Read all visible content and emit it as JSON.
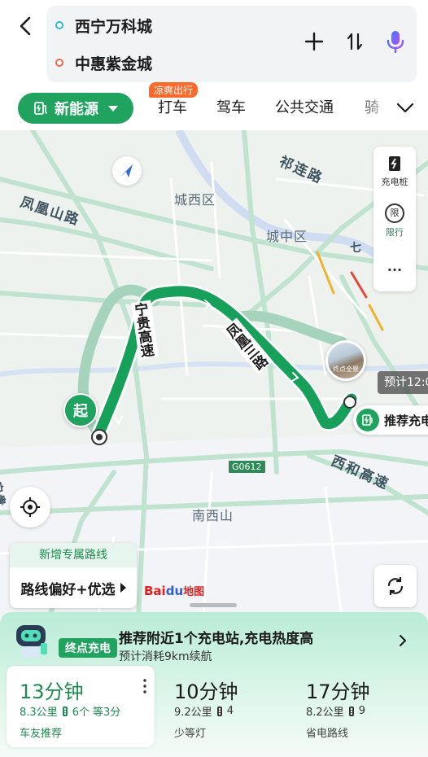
{
  "header": {
    "start": "西宁万科城",
    "end": "中惠紫金城"
  },
  "modes": {
    "nev_label": "新能源",
    "badge": "凉爽出行",
    "items": [
      "打车",
      "驾车",
      "公共交通",
      "骑"
    ]
  },
  "map": {
    "districts": [
      "城西区",
      "城中区",
      "南西山"
    ],
    "roads": [
      "凤凰山路",
      "祁连路",
      "西和高速"
    ],
    "route_roads": [
      "宁贵高速",
      "凤凰三路"
    ],
    "partial_road": "宁贵",
    "partial_road_right": "七",
    "highway_shield": "G0612",
    "side_tools": {
      "charger_label": "充电桩",
      "restrict_icon_text": "限",
      "restrict_label": "限行",
      "more_label": "···"
    },
    "start_marker": "起",
    "destination_photo_label": "终点全景",
    "eta_bubble": "预计12:0",
    "charger_pill": "推荐充电",
    "pref_card": {
      "top": "新增专属路线",
      "bottom": "路线偏好+优选"
    },
    "logo": {
      "bai": "Bai",
      "du": "du",
      "map": "地图"
    }
  },
  "sheet": {
    "ev_tag": "终点充电",
    "ev_title": "推荐附近1个充电站,充电热度高",
    "ev_sub": "预计消耗9km续航",
    "routes": [
      {
        "time": "13分钟",
        "distance": "8.3公里",
        "lights": "6个",
        "extra": "等3分",
        "tag": "车友推荐",
        "selected": true
      },
      {
        "time": "10分钟",
        "distance": "9.2公里",
        "lights": "4",
        "extra": "",
        "tag": "少等灯",
        "selected": false
      },
      {
        "time": "17分钟",
        "distance": "8.2公里",
        "lights": "9",
        "extra": "",
        "tag": "省电路线",
        "selected": false
      }
    ]
  },
  "colors": {
    "brand_green": "#1fa35f",
    "route_green": "#16a05a",
    "alt_route": "#8cc9a8",
    "badge_orange": "#ff6a2c"
  }
}
